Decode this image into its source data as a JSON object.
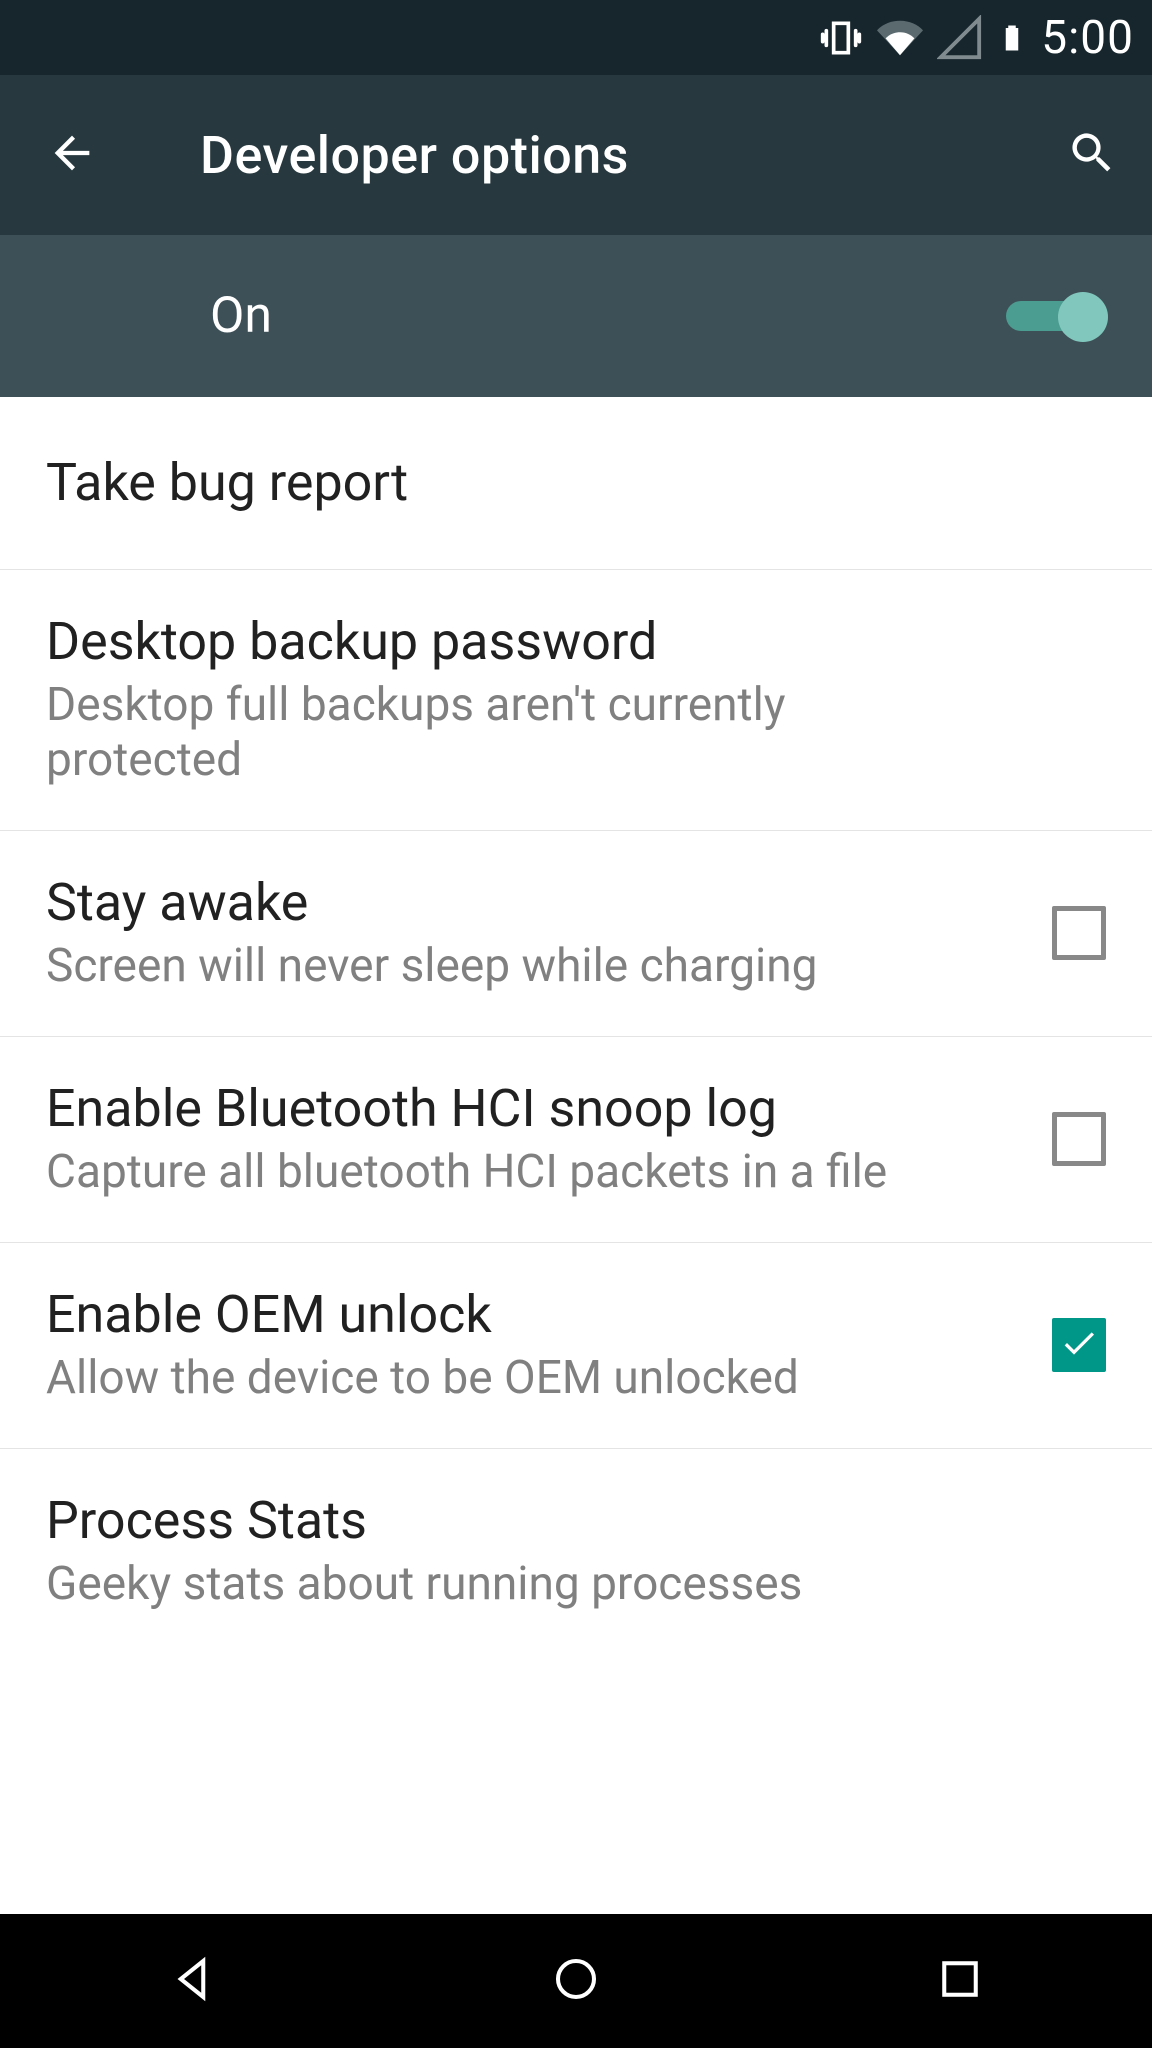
{
  "statusbar": {
    "time": "5:00",
    "icons": [
      "vibrate-icon",
      "wifi-icon",
      "cell-signal-icon",
      "battery-icon"
    ]
  },
  "appbar": {
    "title": "Developer options",
    "back_aria": "Back",
    "search_aria": "Search"
  },
  "master_toggle": {
    "label": "On",
    "state": true
  },
  "items": [
    {
      "key": "bug-report",
      "title": "Take bug report",
      "subtitle": null,
      "control": "none"
    },
    {
      "key": "desktop-backup",
      "title": "Desktop backup password",
      "subtitle": "Desktop full backups aren't currently protected",
      "control": "none"
    },
    {
      "key": "stay-awake",
      "title": "Stay awake",
      "subtitle": "Screen will never sleep while charging",
      "control": "checkbox",
      "checked": false
    },
    {
      "key": "hci-snoop",
      "title": "Enable Bluetooth HCI snoop log",
      "subtitle": "Capture all bluetooth HCI packets in a file",
      "control": "checkbox",
      "checked": false
    },
    {
      "key": "oem-unlock",
      "title": "Enable OEM unlock",
      "subtitle": "Allow the device to be OEM unlocked",
      "control": "checkbox",
      "checked": true
    },
    {
      "key": "process-stats",
      "title": "Process Stats",
      "subtitle": "Geeky stats about running processes",
      "control": "none"
    }
  ],
  "navbar": {
    "back_aria": "Back",
    "home_aria": "Home",
    "recents_aria": "Recents"
  },
  "colors": {
    "accent": "#009688",
    "switch_track": "#4b9c91",
    "switch_thumb": "#81c7bd",
    "statusbar_bg": "#16262c",
    "appbar_bg": "#27393f",
    "toggle_bg": "#3d5057"
  }
}
